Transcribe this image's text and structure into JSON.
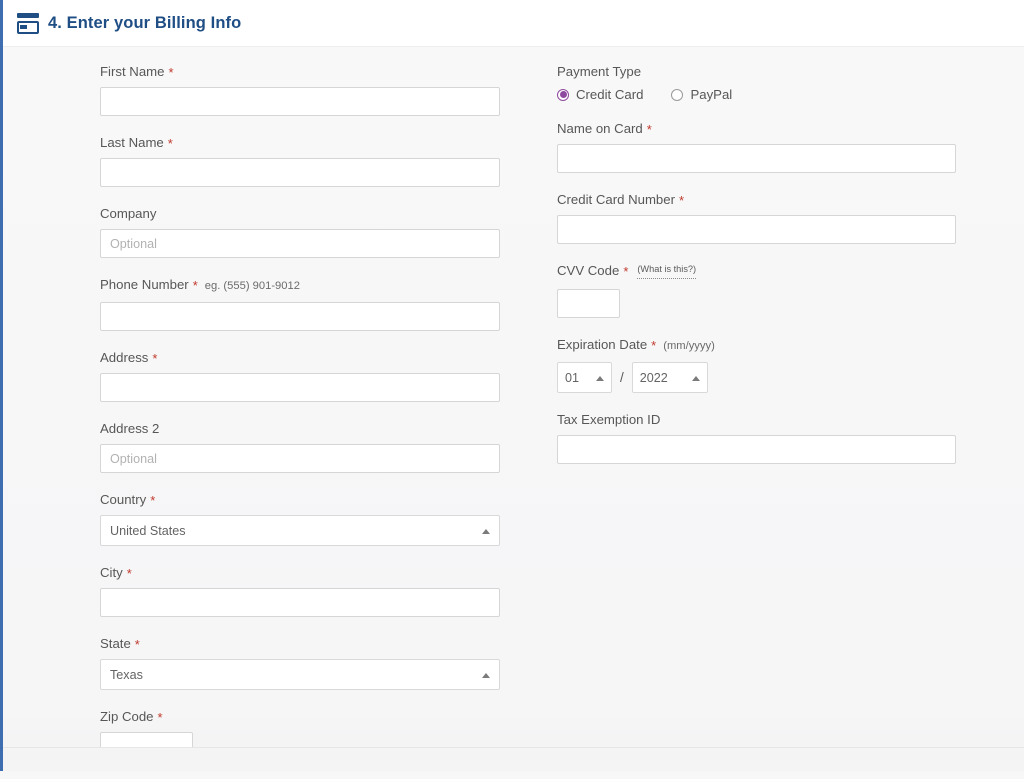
{
  "header": {
    "icon": "credit-card-icon",
    "title": "4. Enter your Billing Info",
    "title_color": "#1f4e85"
  },
  "colors": {
    "accent_blue": "#1f4e85",
    "required_star": "#c0392b",
    "radio_selected": "#8e4a9e",
    "label_text": "#575757",
    "page_background": "#f7f7f8",
    "input_border": "#d6d6d6"
  },
  "left_column": {
    "first_name": {
      "label": "First Name",
      "required": true,
      "value": "",
      "placeholder": ""
    },
    "last_name": {
      "label": "Last Name",
      "required": true,
      "value": "",
      "placeholder": ""
    },
    "company": {
      "label": "Company",
      "required": false,
      "value": "",
      "placeholder": "Optional"
    },
    "phone_number": {
      "label": "Phone Number",
      "required": true,
      "hint": "eg. (555) 901-9012",
      "value": "",
      "placeholder": ""
    },
    "address": {
      "label": "Address",
      "required": true,
      "value": "",
      "placeholder": ""
    },
    "address2": {
      "label": "Address 2",
      "required": false,
      "value": "",
      "placeholder": "Optional"
    },
    "country": {
      "label": "Country",
      "required": true,
      "value": "United States"
    },
    "city": {
      "label": "City",
      "required": true,
      "value": "",
      "placeholder": ""
    },
    "state": {
      "label": "State",
      "required": true,
      "value": "Texas"
    },
    "zip_code": {
      "label": "Zip Code",
      "required": true,
      "value": "",
      "placeholder": ""
    }
  },
  "right_column": {
    "payment_type": {
      "label": "Payment Type",
      "options": [
        {
          "label": "Credit Card",
          "selected": true
        },
        {
          "label": "PayPal",
          "selected": false
        }
      ]
    },
    "name_on_card": {
      "label": "Name on Card",
      "required": true,
      "value": "",
      "placeholder": ""
    },
    "credit_card_number": {
      "label": "Credit Card Number",
      "required": true,
      "value": "",
      "placeholder": ""
    },
    "cvv_code": {
      "label": "CVV Code",
      "required": true,
      "help_link": "(What is this?)",
      "value": "",
      "placeholder": ""
    },
    "expiration_date": {
      "label": "Expiration Date",
      "required": true,
      "format_hint": "(mm/yyyy)",
      "separator": "/",
      "month": "01",
      "year": "2022"
    },
    "tax_exemption_id": {
      "label": "Tax Exemption ID",
      "required": false,
      "value": "",
      "placeholder": ""
    }
  },
  "star": "*"
}
